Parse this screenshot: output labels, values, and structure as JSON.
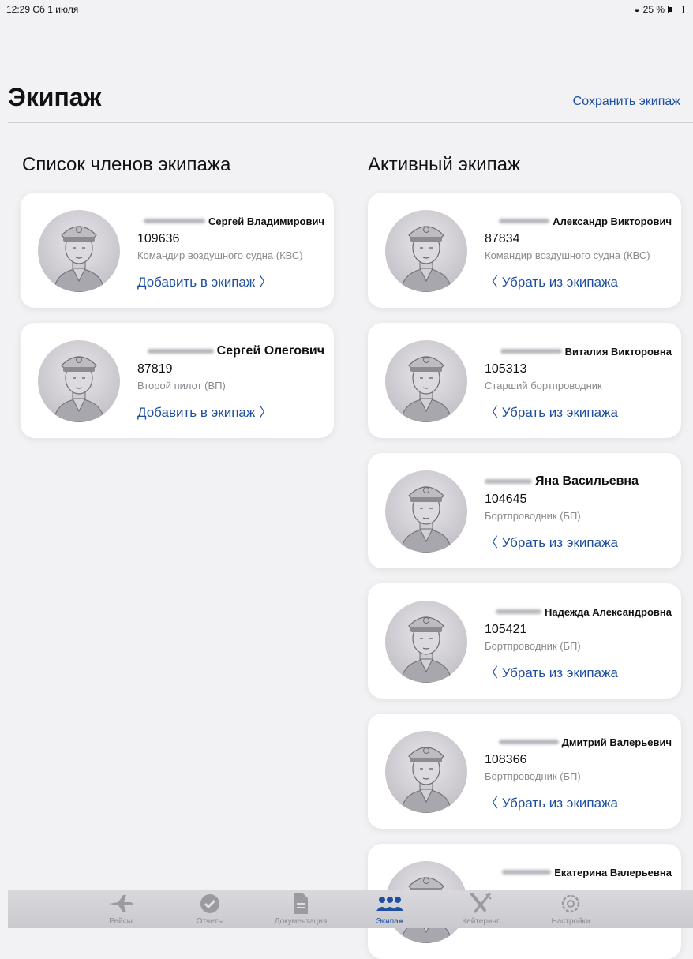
{
  "status": {
    "time": "12:29",
    "date": "Сб 1 июля",
    "battery": "25 %"
  },
  "header": {
    "title": "Экипаж",
    "save_button": "Сохранить экипаж"
  },
  "sections": {
    "list_title": "Список членов экипажа",
    "active_title": "Активный экипаж"
  },
  "crew_list": [
    {
      "name": "Сергей Владимирович",
      "tab_number": "109636",
      "position": "Командир воздушного судна (КВС)",
      "action": "Добавить в экипаж 〉"
    },
    {
      "name": "Сергей Олегович",
      "tab_number": "87819",
      "position": "Второй пилот (ВП)",
      "action": "Добавить в экипаж 〉"
    }
  ],
  "active_crew": [
    {
      "name": "Александр Викторович",
      "tab_number": "87834",
      "position": "Командир воздушного судна (КВС)",
      "action": "〈 Убрать из экипажа"
    },
    {
      "name": "Виталия Викторовна",
      "tab_number": "105313",
      "position": "Старший бортпроводник",
      "action": "〈 Убрать из экипажа"
    },
    {
      "name": "Яна Васильевна",
      "tab_number": "104645",
      "position": "Бортпроводник (БП)",
      "action": "〈 Убрать из экипажа"
    },
    {
      "name": "Надежда Александровна",
      "tab_number": "105421",
      "position": "Бортпроводник (БП)",
      "action": "〈 Убрать из экипажа"
    },
    {
      "name": "Дмитрий Валерьевич",
      "tab_number": "108366",
      "position": "Бортпроводник (БП)",
      "action": "〈 Убрать из экипажа"
    },
    {
      "name": "Екатерина Валерьевна",
      "tab_number": "",
      "position": "",
      "action": ""
    }
  ],
  "tabbar": {
    "items": [
      {
        "label": "Рейсы",
        "icon": "airplane-icon"
      },
      {
        "label": "Отчеты",
        "icon": "checkmark-icon"
      },
      {
        "label": "Документация",
        "icon": "document-icon"
      },
      {
        "label": "Экипаж",
        "icon": "crew-icon"
      },
      {
        "label": "Кейтеринг",
        "icon": "catering-icon"
      },
      {
        "label": "Настройки",
        "icon": "settings-icon"
      }
    ],
    "active": "Экипаж"
  },
  "colors": {
    "accent": "#1e4fa0",
    "background": "#f2f2f4",
    "card": "#ffffff",
    "muted": "#8a8a90"
  }
}
